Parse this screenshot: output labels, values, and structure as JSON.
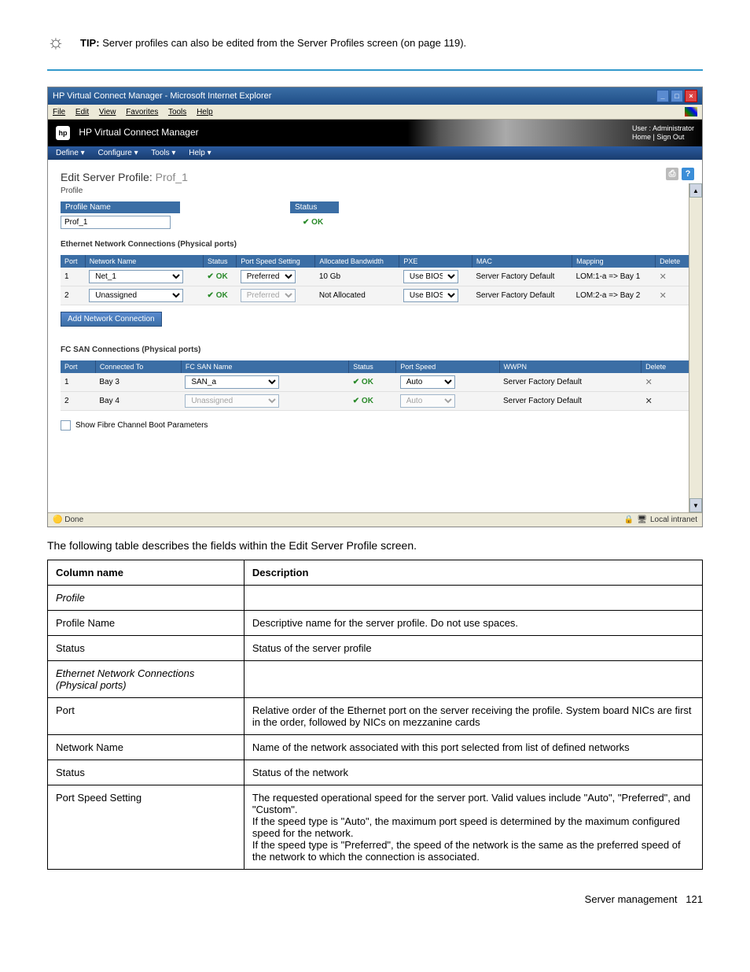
{
  "tip": {
    "label": "TIP:",
    "text": "Server profiles can also be edited from the Server Profiles screen (on page 119)."
  },
  "screenshot": {
    "window_title": "HP Virtual Connect Manager - Microsoft Internet Explorer",
    "menubar": [
      "File",
      "Edit",
      "View",
      "Favorites",
      "Tools",
      "Help"
    ],
    "app_title": "HP Virtual Connect Manager",
    "user_line": "User : Administrator",
    "home_link": "Home",
    "signout_link": "Sign Out",
    "navmenu": [
      "Define ▾",
      "Configure ▾",
      "Tools ▾",
      "Help ▾"
    ],
    "page_title_prefix": "Edit Server Profile:",
    "page_title_name": "Prof_1",
    "sub_profile": "Profile",
    "profile_panel": {
      "name_hdr": "Profile Name",
      "status_hdr": "Status",
      "name_value": "Prof_1",
      "status_value": "OK"
    },
    "eth_section": "Ethernet Network Connections (Physical ports)",
    "eth_cols": {
      "port": "Port",
      "net": "Network Name",
      "status": "Status",
      "speed": "Port Speed Setting",
      "bw": "Allocated Bandwidth",
      "pxe": "PXE",
      "mac": "MAC",
      "map": "Mapping",
      "del": "Delete"
    },
    "eth_rows": [
      {
        "port": "1",
        "net": "Net_1",
        "status": "OK",
        "speed": "Preferred",
        "bw": "10 Gb",
        "pxe": "Use BIOS",
        "mac": "Server Factory Default",
        "map": "LOM:1-a => Bay 1"
      },
      {
        "port": "2",
        "net": "Unassigned",
        "status": "OK",
        "speed": "Preferred",
        "bw": "Not Allocated",
        "pxe": "Use BIOS",
        "mac": "Server Factory Default",
        "map": "LOM:2-a => Bay 2"
      }
    ],
    "add_btn": "Add Network Connection",
    "fc_section": "FC SAN Connections (Physical ports)",
    "fc_cols": {
      "port": "Port",
      "conn": "Connected To",
      "san": "FC SAN Name",
      "status": "Status",
      "speed": "Port Speed",
      "wwpn": "WWPN",
      "del": "Delete"
    },
    "fc_rows": [
      {
        "port": "1",
        "conn": "Bay 3",
        "san": "SAN_a",
        "status": "OK",
        "speed": "Auto",
        "wwpn": "Server Factory Default"
      },
      {
        "port": "2",
        "conn": "Bay 4",
        "san": "Unassigned",
        "status": "OK",
        "speed": "Auto",
        "wwpn": "Server Factory Default"
      }
    ],
    "boot_chk": "Show Fibre Channel Boot Parameters",
    "status_done": "Done",
    "status_zone": "Local intranet"
  },
  "intro": "The following table describes the fields within the Edit Server Profile screen.",
  "table": {
    "hdr_col": "Column name",
    "hdr_desc": "Description",
    "rows": [
      {
        "col": "Profile",
        "em": true,
        "desc": ""
      },
      {
        "col": "Profile Name",
        "desc": "Descriptive name for the server profile. Do not use spaces."
      },
      {
        "col": "Status",
        "desc": "Status of the server profile"
      },
      {
        "col": "Ethernet Network Connections (Physical ports)",
        "em": true,
        "desc": ""
      },
      {
        "col": "Port",
        "desc": "Relative order of the Ethernet port on the server receiving the profile. System board NICs are first in the order, followed by NICs on mezzanine cards"
      },
      {
        "col": "Network Name",
        "desc": "Name of the network associated with this port selected from list of defined networks"
      },
      {
        "col": "Status",
        "desc": "Status of the network"
      },
      {
        "col": "Port Speed Setting",
        "desc": "The requested operational speed for the server port. Valid values include \"Auto\", \"Preferred\", and \"Custom\".\nIf the speed type is \"Auto\", the maximum port speed is determined by the maximum configured speed for the network.\nIf the speed type is \"Preferred\", the speed of the network is the same as the preferred speed of the network to which the connection is associated."
      }
    ]
  },
  "footer": {
    "text": "Server management",
    "page": "121"
  }
}
